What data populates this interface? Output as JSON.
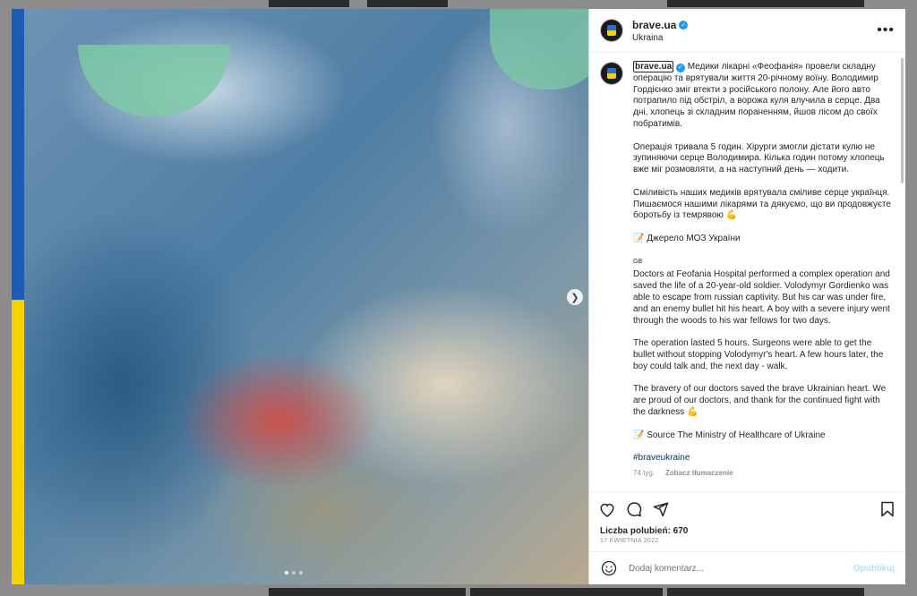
{
  "post": {
    "username": "brave.ua",
    "location": "Ukraina",
    "verified_icon": "verified-badge-icon",
    "more_icon": "more-options-icon"
  },
  "caption": {
    "username": "brave.ua",
    "paragraphs": [
      "Медики лікарні «Феофанія» провели складну операцію та врятували життя 20-річному воїну. Володимир Гордієнко зміг втекти з російського полону. Але його авто потрапило під обстріл, а ворожа куля влучила в серце. Два дні, хлопець зі складним пораненням, йшов лісом до своїх побратимів.",
      "Операція тривала 5 годин. Хірурги змогли дістати кулю не зупиняючи серце Володимира. Кілька годин потому хлопець вже міг розмовляти, а на наступний день — ходити.",
      "Сміливість наших медиків врятувала сміливе серце українця. Пишаємося нашими лікарями та дякуємо, що ви продовжуєте боротьбу із темрявою 💪",
      "📝 Джерело МОЗ України"
    ],
    "en_flag_label": "GB",
    "paragraphs_en": [
      "Doctors at Feofania Hospital performed a complex operation and saved the life of a 20-year-old soldier. Volodymyr Gordienko was able to escape from russian captivity. But his car was under fire, and an enemy bullet hit his heart. A boy with a severe injury went through the woods to his war fellows for two days.",
      "The operation lasted 5 hours. Surgeons were able to get the bullet without stopping Volodymyr's heart. A few hours later, the boy could talk and, the next day - walk.",
      "The bravery of our doctors saved the brave Ukrainian heart. We are proud of our doctors, and thank for the continued fight with the darkness 💪",
      "📝 Source The Ministry of Healthcare of Ukraine"
    ],
    "hashtag": "#braveukraine",
    "age": "74 tyg.",
    "translate_label": "Zobacz tłumaczenie"
  },
  "actions": {
    "like_icon": "heart-icon",
    "comment_icon": "comment-icon",
    "share_icon": "share-icon",
    "save_icon": "bookmark-icon"
  },
  "likes_text": "Liczba polubień: 670",
  "date_text": "17 KWIETNIA 2022",
  "comment": {
    "placeholder": "Dodaj komentarz...",
    "publish_label": "Opublikuj",
    "emoji_icon": "emoji-icon"
  },
  "media": {
    "next_icon": "chevron-right-icon",
    "slide_count": 3,
    "active_slide": 1,
    "flag_colors": [
      "#1e5bb5",
      "#f6d300"
    ]
  }
}
